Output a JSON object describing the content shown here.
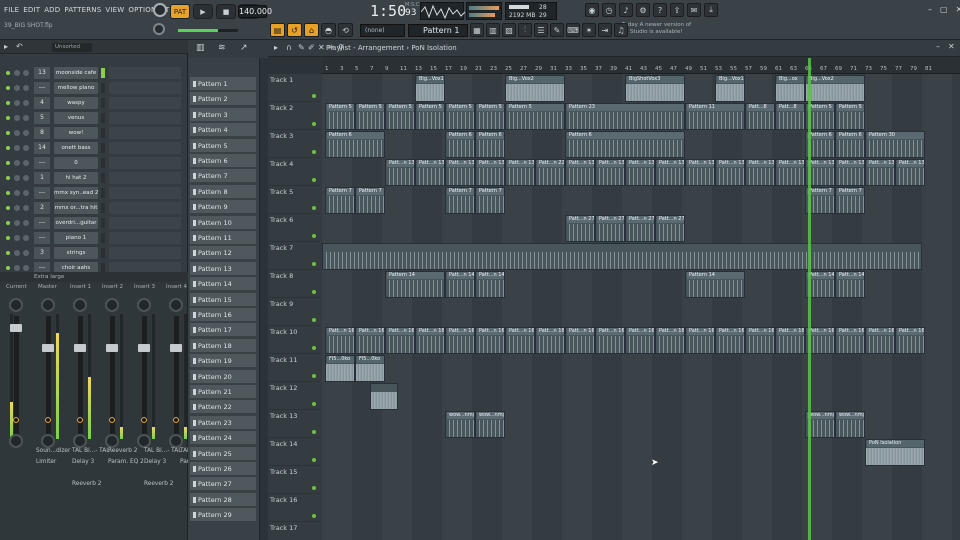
{
  "menu": [
    "FILE",
    "EDIT",
    "ADD",
    "PATTERNS",
    "VIEW",
    "OPTIONS",
    "TOOLS",
    "HELP"
  ],
  "project_file": "39_BIG SHOT.flp",
  "transport": {
    "tempo": "140.000",
    "time": "1:50",
    "time_sub": "93",
    "time_unit": "M:S:CS"
  },
  "cpu": {
    "memory": "2192 MB",
    "cpu": "28",
    "poly": "29"
  },
  "news": {
    "line1": "Today  A newer version of",
    "line2": "FL Studio is available!"
  },
  "toolbar": {
    "preset": "(none)",
    "pattern": "Pattern 1"
  },
  "channel_rack": {
    "filter": "Unsorted",
    "channels": [
      {
        "num": "13",
        "name": "moonside cafe"
      },
      {
        "num": "---",
        "name": "mellow piano"
      },
      {
        "num": "4",
        "name": "waspy"
      },
      {
        "num": "5",
        "name": "venus"
      },
      {
        "num": "8",
        "name": "wow!"
      },
      {
        "num": "14",
        "name": "onett bass"
      },
      {
        "num": "---",
        "name": "0"
      },
      {
        "num": "1",
        "name": "hi hat 2"
      },
      {
        "num": "---",
        "name": "mmx syn..ead 2"
      },
      {
        "num": "2",
        "name": "mmx or...tra hit"
      },
      {
        "num": "---",
        "name": "overdri...guitar"
      },
      {
        "num": "---",
        "name": "piano 1"
      },
      {
        "num": "3",
        "name": "strings"
      },
      {
        "num": "---",
        "name": "choir aahs"
      }
    ]
  },
  "mixer": {
    "header": "Extra large",
    "strips": [
      {
        "label": "Current"
      },
      {
        "label": "Master"
      },
      {
        "label": "Insert 1"
      },
      {
        "label": "Insert 2"
      },
      {
        "label": "Insert 3"
      },
      {
        "label": "Insert 4"
      }
    ],
    "fx_names": [
      {
        "col": "Soun...dizer",
        "row": "Limiter"
      },
      {
        "col": "TAL Bi...- TAL",
        "row": "Delay 3"
      },
      {
        "col": "Reeverb 2",
        "row": "Param. EQ 2"
      },
      {
        "col": "TAL Bi...- TAL",
        "row": "Delay 3"
      },
      {
        "col": "TAL Bi...- TAL",
        "row": "Param. EQ 2"
      }
    ],
    "fx_extra": [
      "Reeverb 2",
      "Reeverb 2"
    ]
  },
  "patterns": [
    "Pattern 1",
    "Pattern 2",
    "Pattern 3",
    "Pattern 4",
    "Pattern 5",
    "Pattern 6",
    "Pattern 7",
    "Pattern 8",
    "Pattern 9",
    "Pattern 10",
    "Pattern 11",
    "Pattern 12",
    "Pattern 13",
    "Pattern 14",
    "Pattern 15",
    "Pattern 16",
    "Pattern 17",
    "Pattern 18",
    "Pattern 19",
    "Pattern 20",
    "Pattern 21",
    "Pattern 22",
    "Pattern 23",
    "Pattern 24",
    "Pattern 25",
    "Pattern 26",
    "Pattern 27",
    "Pattern 28",
    "Pattern 29"
  ],
  "playlist": {
    "title": "Playlist - Arrangement",
    "breadcrumb": "PoN Isolation",
    "ruler": [
      "1",
      "3",
      "5",
      "7",
      "9",
      "11",
      "13",
      "15",
      "17",
      "19",
      "21",
      "23",
      "25",
      "27",
      "29",
      "31",
      "33",
      "35",
      "37",
      "39",
      "41",
      "43",
      "45",
      "47",
      "49",
      "51",
      "53",
      "55",
      "57",
      "59",
      "61",
      "63",
      "65",
      "67",
      "69",
      "71",
      "73",
      "75",
      "77",
      "79",
      "81"
    ],
    "tracks": [
      "Track 1",
      "Track 2",
      "Track 3",
      "Track 4",
      "Track 5",
      "Track 6",
      "Track 7",
      "Track 8",
      "Track 9",
      "Track 10",
      "Track 11",
      "Track 12",
      "Track 13",
      "Track 14",
      "Track 15",
      "Track 16",
      "Track 17"
    ],
    "clips": [
      {
        "track": 0,
        "start": 93,
        "len": 30,
        "label": "Big...Vox1",
        "audio": true
      },
      {
        "track": 0,
        "start": 183,
        "len": 60,
        "label": "Big...Vox2",
        "audio": true
      },
      {
        "track": 0,
        "start": 303,
        "len": 60,
        "label": "BigShotVox3",
        "audio": true
      },
      {
        "track": 0,
        "start": 393,
        "len": 30,
        "label": "Big...Vox1",
        "audio": true
      },
      {
        "track": 0,
        "start": 453,
        "len": 30,
        "label": "Big...ox",
        "audio": true
      },
      {
        "track": 0,
        "start": 483,
        "len": 60,
        "label": "Big...Vox2",
        "audio": true
      },
      {
        "track": 1,
        "start": 3,
        "len": 30,
        "label": "Pattern 5"
      },
      {
        "track": 1,
        "start": 33,
        "len": 30,
        "label": "Pattern 5"
      },
      {
        "track": 1,
        "start": 63,
        "len": 30,
        "label": "Pattern 5"
      },
      {
        "track": 1,
        "start": 93,
        "len": 30,
        "label": "Pattern 5"
      },
      {
        "track": 1,
        "start": 123,
        "len": 30,
        "label": "Pattern 5"
      },
      {
        "track": 1,
        "start": 153,
        "len": 30,
        "label": "Pattern 5"
      },
      {
        "track": 1,
        "start": 183,
        "len": 60,
        "label": "Pattern 5"
      },
      {
        "track": 1,
        "start": 243,
        "len": 120,
        "label": "Pattern 23"
      },
      {
        "track": 1,
        "start": 363,
        "len": 60,
        "label": "Pattern 11"
      },
      {
        "track": 1,
        "start": 423,
        "len": 30,
        "label": "Patt...8"
      },
      {
        "track": 1,
        "start": 453,
        "len": 30,
        "label": "Patt...8"
      },
      {
        "track": 1,
        "start": 483,
        "len": 30,
        "label": "Pattern 5"
      },
      {
        "track": 1,
        "start": 513,
        "len": 30,
        "label": "Pattern 5"
      },
      {
        "track": 2,
        "start": 3,
        "len": 60,
        "label": "Pattern 6"
      },
      {
        "track": 2,
        "start": 123,
        "len": 30,
        "label": "Pattern 6"
      },
      {
        "track": 2,
        "start": 153,
        "len": 30,
        "label": "Pattern 6"
      },
      {
        "track": 2,
        "start": 243,
        "len": 120,
        "label": "Pattern 6"
      },
      {
        "track": 2,
        "start": 483,
        "len": 30,
        "label": "Pattern 6"
      },
      {
        "track": 2,
        "start": 513,
        "len": 30,
        "label": "Pattern 6"
      },
      {
        "track": 2,
        "start": 543,
        "len": 60,
        "label": "Pattern 30"
      },
      {
        "track": 3,
        "start": 63,
        "len": 30,
        "label": "Patt...n 13"
      },
      {
        "track": 3,
        "start": 93,
        "len": 30,
        "label": "Patt...n 13"
      },
      {
        "track": 3,
        "start": 123,
        "len": 30,
        "label": "Patt...n 13"
      },
      {
        "track": 3,
        "start": 153,
        "len": 30,
        "label": "Patt...n 13"
      },
      {
        "track": 3,
        "start": 183,
        "len": 30,
        "label": "Patt...n 13"
      },
      {
        "track": 3,
        "start": 213,
        "len": 30,
        "label": "Patt...n 22"
      },
      {
        "track": 3,
        "start": 243,
        "len": 30,
        "label": "Patt...n 13"
      },
      {
        "track": 3,
        "start": 273,
        "len": 30,
        "label": "Patt...n 13"
      },
      {
        "track": 3,
        "start": 303,
        "len": 30,
        "label": "Patt...n 13"
      },
      {
        "track": 3,
        "start": 333,
        "len": 30,
        "label": "Patt...n 13"
      },
      {
        "track": 3,
        "start": 363,
        "len": 30,
        "label": "Patt...n 13"
      },
      {
        "track": 3,
        "start": 393,
        "len": 30,
        "label": "Patt...n 13"
      },
      {
        "track": 3,
        "start": 423,
        "len": 30,
        "label": "Patt...n 13"
      },
      {
        "track": 3,
        "start": 453,
        "len": 30,
        "label": "Patt...n 13"
      },
      {
        "track": 3,
        "start": 483,
        "len": 30,
        "label": "Patt...n 13"
      },
      {
        "track": 3,
        "start": 513,
        "len": 30,
        "label": "Patt...n 13"
      },
      {
        "track": 3,
        "start": 543,
        "len": 30,
        "label": "Patt...n 13"
      },
      {
        "track": 3,
        "start": 573,
        "len": 30,
        "label": "Patt...n 13"
      },
      {
        "track": 4,
        "start": 3,
        "len": 30,
        "label": "Pattern 7"
      },
      {
        "track": 4,
        "start": 33,
        "len": 30,
        "label": "Pattern 7"
      },
      {
        "track": 4,
        "start": 123,
        "len": 30,
        "label": "Pattern 7"
      },
      {
        "track": 4,
        "start": 153,
        "len": 30,
        "label": "Pattern 7"
      },
      {
        "track": 4,
        "start": 483,
        "len": 30,
        "label": "Pattern 7"
      },
      {
        "track": 4,
        "start": 513,
        "len": 30,
        "label": "Pattern 7"
      },
      {
        "track": 5,
        "start": 243,
        "len": 30,
        "label": "Patt...n 27"
      },
      {
        "track": 5,
        "start": 273,
        "len": 30,
        "label": "Patt...n 27"
      },
      {
        "track": 5,
        "start": 303,
        "len": 30,
        "label": "Patt...n 27"
      },
      {
        "track": 5,
        "start": 333,
        "len": 30,
        "label": "Patt...n 27"
      },
      {
        "track": 6,
        "start": 0,
        "len": 600,
        "label": ""
      },
      {
        "track": 7,
        "start": 63,
        "len": 60,
        "label": "Pattern 14"
      },
      {
        "track": 7,
        "start": 123,
        "len": 30,
        "label": "Patt...n 14"
      },
      {
        "track": 7,
        "start": 153,
        "len": 30,
        "label": "Patt...n 14"
      },
      {
        "track": 7,
        "start": 363,
        "len": 60,
        "label": "Pattern 14"
      },
      {
        "track": 7,
        "start": 483,
        "len": 30,
        "label": "Patt...n 14"
      },
      {
        "track": 7,
        "start": 513,
        "len": 30,
        "label": "Patt...n 14"
      },
      {
        "track": 9,
        "start": 3,
        "len": 30,
        "label": "Patt...n 16"
      },
      {
        "track": 9,
        "start": 33,
        "len": 30,
        "label": "Patt...n 16"
      },
      {
        "track": 9,
        "start": 63,
        "len": 30,
        "label": "Patt...n 16"
      },
      {
        "track": 9,
        "start": 93,
        "len": 30,
        "label": "Patt...n 16"
      },
      {
        "track": 9,
        "start": 123,
        "len": 30,
        "label": "Patt...n 16"
      },
      {
        "track": 9,
        "start": 153,
        "len": 30,
        "label": "Patt...n 16"
      },
      {
        "track": 9,
        "start": 183,
        "len": 30,
        "label": "Patt...n 16"
      },
      {
        "track": 9,
        "start": 213,
        "len": 30,
        "label": "Patt...n 16"
      },
      {
        "track": 9,
        "start": 243,
        "len": 30,
        "label": "Patt...n 16"
      },
      {
        "track": 9,
        "start": 273,
        "len": 30,
        "label": "Patt...n 16"
      },
      {
        "track": 9,
        "start": 303,
        "len": 30,
        "label": "Patt...n 16"
      },
      {
        "track": 9,
        "start": 333,
        "len": 30,
        "label": "Patt...n 16"
      },
      {
        "track": 9,
        "start": 363,
        "len": 30,
        "label": "Patt...n 16"
      },
      {
        "track": 9,
        "start": 393,
        "len": 30,
        "label": "Patt...n 16"
      },
      {
        "track": 9,
        "start": 423,
        "len": 30,
        "label": "Patt...n 16"
      },
      {
        "track": 9,
        "start": 453,
        "len": 30,
        "label": "Patt...n 16"
      },
      {
        "track": 9,
        "start": 483,
        "len": 30,
        "label": "Patt...n 16"
      },
      {
        "track": 9,
        "start": 513,
        "len": 30,
        "label": "Patt...n 16"
      },
      {
        "track": 9,
        "start": 543,
        "len": 30,
        "label": "Patt...n 16"
      },
      {
        "track": 9,
        "start": 573,
        "len": 30,
        "label": "Patt...n 16"
      },
      {
        "track": 10,
        "start": 3,
        "len": 30,
        "label": "Fl5...0ko",
        "audio": true
      },
      {
        "track": 10,
        "start": 33,
        "len": 30,
        "label": "Fl5...0ko",
        "audio": true
      },
      {
        "track": 11,
        "start": 48,
        "len": 28,
        "label": "",
        "audio": true
      },
      {
        "track": 12,
        "start": 123,
        "len": 30,
        "label": "wow...nmg"
      },
      {
        "track": 12,
        "start": 153,
        "len": 30,
        "label": "wow...nmg"
      },
      {
        "track": 12,
        "start": 483,
        "len": 30,
        "label": "wow...nmg"
      },
      {
        "track": 12,
        "start": 513,
        "len": 30,
        "label": "wow...nmg"
      },
      {
        "track": 13,
        "start": 543,
        "len": 60,
        "label": "PoN Isolation",
        "audio": true
      }
    ]
  }
}
